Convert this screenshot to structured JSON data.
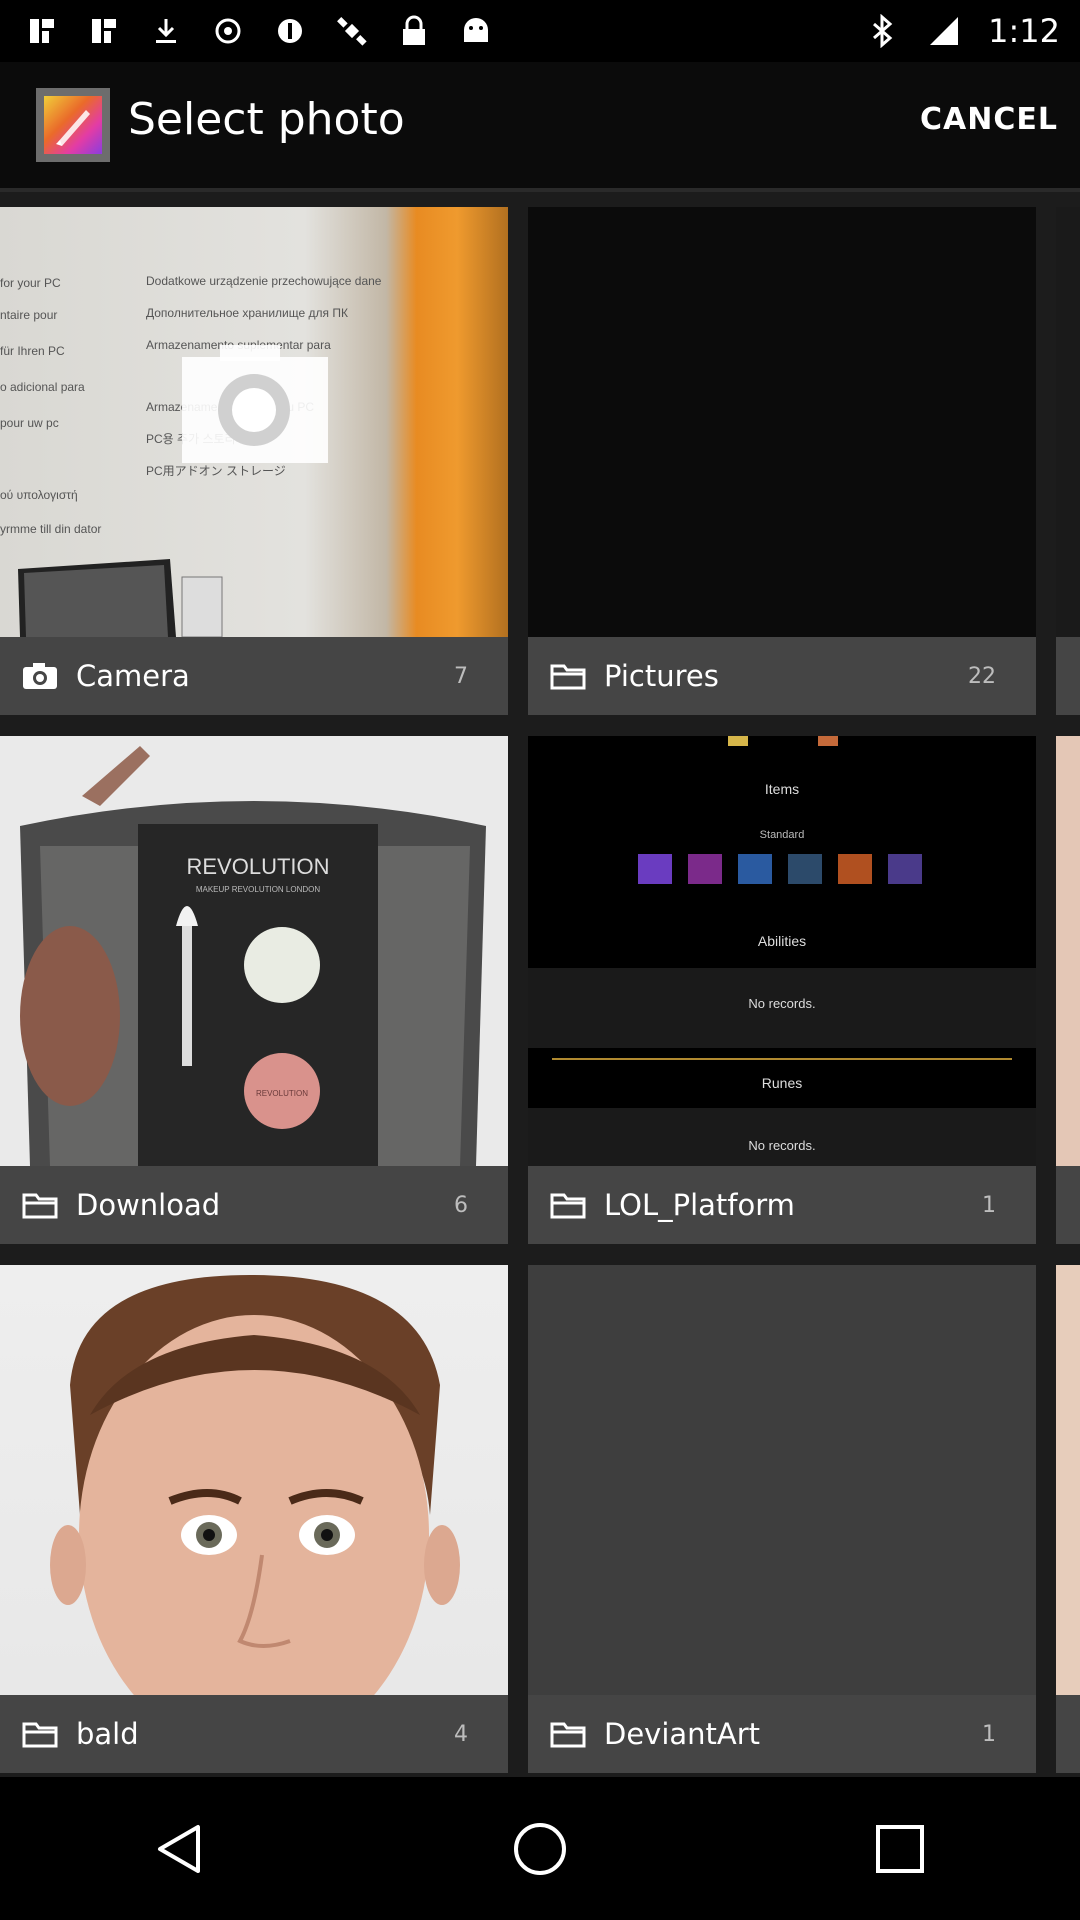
{
  "status_bar": {
    "time": "1:12",
    "left_icons": [
      "app-icon",
      "app-icon",
      "download-icon",
      "record-icon",
      "info-circle-icon",
      "satellite-icon",
      "lock-icon",
      "android-icon"
    ],
    "right_icons": [
      "bluetooth-icon",
      "signal-icon"
    ]
  },
  "action_bar": {
    "title": "Select photo",
    "cancel_label": "CANCEL"
  },
  "albums": [
    {
      "name": "Camera",
      "count": "7",
      "icon": "camera-icon"
    },
    {
      "name": "Pictures",
      "count": "22",
      "icon": "folder-icon"
    },
    {
      "name": "Download",
      "count": "6",
      "icon": "folder-icon"
    },
    {
      "name": "LOL_Platform",
      "count": "1",
      "icon": "folder-icon"
    },
    {
      "name": "bald",
      "count": "4",
      "icon": "folder-icon"
    },
    {
      "name": "DeviantArt",
      "count": "1",
      "icon": "folder-icon"
    }
  ],
  "thumb_text": {
    "camera_lines": [
      "for your PC",
      "ntaire pour",
      "für Ihren PC",
      "o adicional para",
      "pour uw pc",
      "ού υπολογιστή",
      "yrmme till din dator",
      "Dodatkowe urządzenie przechowujące dane",
      "Дополнительное хранилище для ПК",
      "Armazenamento suplementar para",
      "Armazenamento para o seu PC",
      "PC용 추가 스토리지",
      "PC用アドオン ストレージ"
    ],
    "download_brand": "REVOLUTION",
    "download_sub": "MAKEUP REVOLUTION LONDON",
    "download_pan": "REVOLUTION",
    "lol_items": "Items",
    "lol_standard": "Standard",
    "lol_abilities": "Abilities",
    "lol_no_records_1": "No records.",
    "lol_runes": "Runes",
    "lol_no_records_2": "No records."
  },
  "colors": {
    "status_bar_bg": "#000000",
    "action_bar_bg": "#0b0b0b",
    "grid_bg": "#1c1c1c",
    "label_bar_bg": "#464646"
  }
}
